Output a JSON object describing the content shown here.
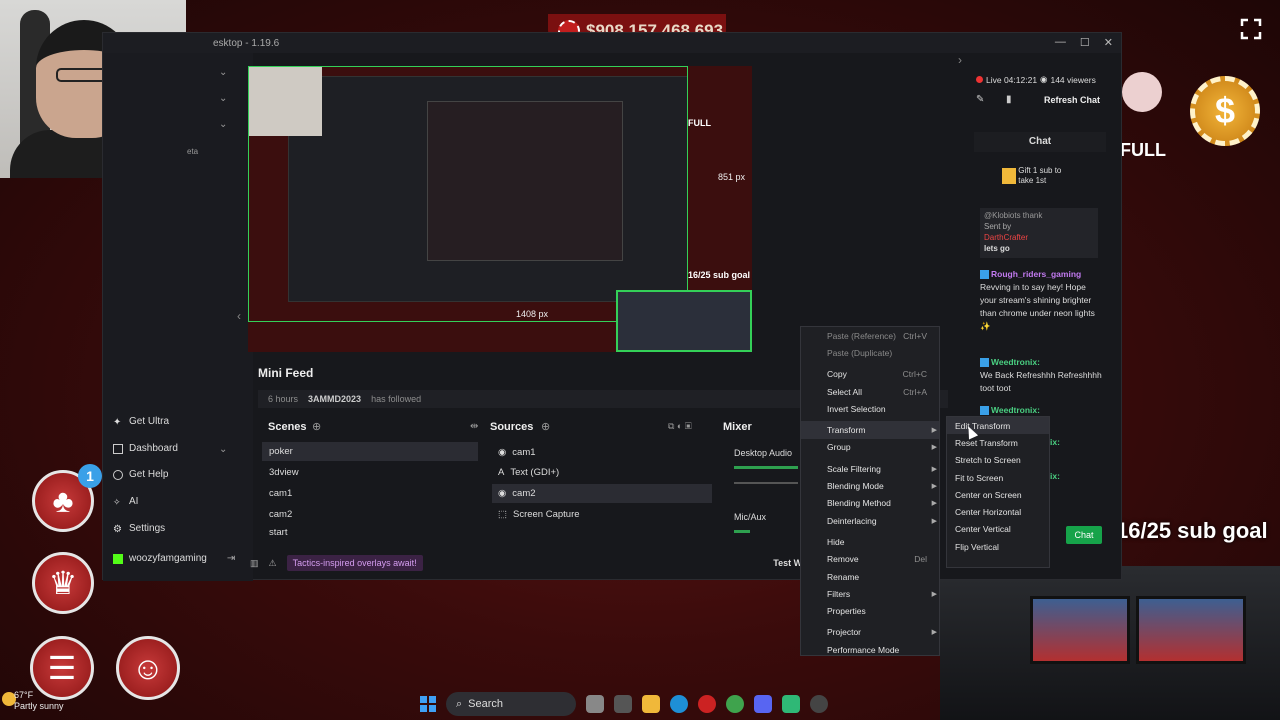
{
  "casino": {
    "balance": "$908,157,468,693",
    "full_label": "FULL",
    "goal": "16/25 sub goal",
    "notification_count": "1"
  },
  "obs": {
    "title": "esktop - 1.19.6",
    "beta_tag": "eta",
    "sidebar": [
      {
        "label": "Get Ultra",
        "icon": "sparkle-icon"
      },
      {
        "label": "Dashboard",
        "icon": "dashboard-icon"
      },
      {
        "label": "Get Help",
        "icon": "help-icon"
      },
      {
        "label": "AI",
        "icon": "ai-icon"
      },
      {
        "label": "Settings",
        "icon": "gear-icon"
      }
    ],
    "user": "woozyfamgaming",
    "preview": {
      "width_label": "1408  px",
      "height_label": "851  px",
      "goal_overlay": "16/25 sub goal",
      "full_overlay": "FULL"
    },
    "minifeed": {
      "title": "Mini Feed",
      "time": "6 hours",
      "user": "3AMMD2023",
      "action": "has followed"
    },
    "scenes": {
      "title": "Scenes",
      "items": [
        "poker",
        "3dview",
        "cam1",
        "cam2",
        "start"
      ],
      "selected": 0
    },
    "sources": {
      "title": "Sources",
      "items": [
        {
          "label": "cam1",
          "icon": "webcam-icon"
        },
        {
          "label": "Text (GDI+)",
          "icon": "text-icon"
        },
        {
          "label": "cam2",
          "icon": "webcam-icon"
        },
        {
          "label": "Screen Capture",
          "icon": "screen-capture-icon"
        }
      ],
      "selected": 2
    },
    "mixer": {
      "title": "Mixer",
      "tracks": [
        "Desktop Audio",
        "Mic/Aux"
      ]
    },
    "tip": "Tactics-inspired overlays await!",
    "test_widget": "Test Wid"
  },
  "chat": {
    "live_time": "Live 04:12:21",
    "viewers": "144 viewers",
    "refresh_label": "Refresh Chat",
    "title": "Chat",
    "gift_text": "Gift 1 sub to take 1st",
    "pinned": {
      "sent_by": "Sent by",
      "user": "DarthCrafter",
      "text": "lets go",
      "partial": "@Klobiots thank"
    },
    "messages": [
      {
        "user": "Rough_riders_gaming",
        "text": "Revving in to say hey! Hope your stream's shining brighter than chrome under neon lights ✨"
      },
      {
        "user": "Weedtronix:",
        "text": "We Back Refreshhh Refreshhhh toot toot"
      },
      {
        "user": "Weedtronix:",
        "text": ""
      },
      {
        "user": "ix:",
        "text": ""
      },
      {
        "user": "ix:",
        "text": ""
      }
    ],
    "chat_button": "Chat"
  },
  "context_menu": {
    "items": [
      {
        "label": "Paste (Reference)",
        "shortcut": "Ctrl+V",
        "dim": true
      },
      {
        "label": "Paste (Duplicate)",
        "shortcut": "",
        "dim": true
      },
      {
        "sep": true
      },
      {
        "label": "Copy",
        "shortcut": "Ctrl+C"
      },
      {
        "label": "Select All",
        "shortcut": "Ctrl+A"
      },
      {
        "label": "Invert Selection",
        "shortcut": ""
      },
      {
        "sep": true
      },
      {
        "label": "Transform",
        "submenu": true,
        "highlight": true
      },
      {
        "label": "Group",
        "submenu": true
      },
      {
        "sep": true
      },
      {
        "label": "Scale Filtering",
        "submenu": true
      },
      {
        "label": "Blending Mode",
        "submenu": true
      },
      {
        "label": "Blending Method",
        "submenu": true
      },
      {
        "label": "Deinterlacing",
        "submenu": true
      },
      {
        "sep": true
      },
      {
        "label": "Hide",
        "shortcut": ""
      },
      {
        "label": "Remove",
        "shortcut": "Del"
      },
      {
        "label": "Rename",
        "shortcut": ""
      },
      {
        "label": "Filters",
        "submenu": true
      },
      {
        "label": "Properties",
        "shortcut": ""
      },
      {
        "sep": true
      },
      {
        "label": "Projector",
        "submenu": true
      },
      {
        "label": "Performance Mode",
        "shortcut": ""
      }
    ],
    "transform_submenu": [
      "Edit Transform",
      "Reset Transform",
      "Stretch to Screen",
      "Fit to Screen",
      "Center on Screen",
      "Center Horizontal",
      "Center Vertical",
      "Flip Vertical"
    ]
  },
  "taskbar": {
    "search": "Search",
    "weather_temp": "67°F",
    "weather_desc": "Partly sunny"
  }
}
